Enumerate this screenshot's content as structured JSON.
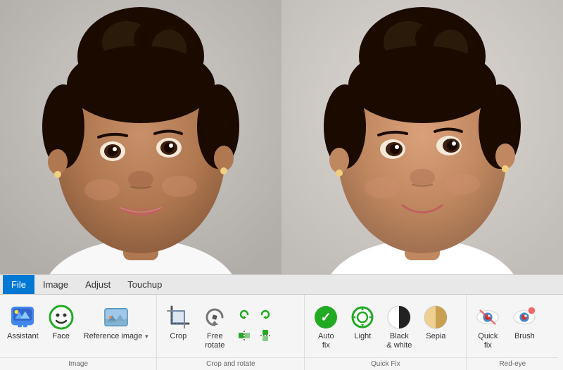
{
  "photos": {
    "left_alt": "Original portrait photo of young girl",
    "right_alt": "Edited portrait photo of young girl"
  },
  "menu": {
    "items": [
      {
        "id": "file",
        "label": "File",
        "active": true
      },
      {
        "id": "image",
        "label": "Image",
        "active": false
      },
      {
        "id": "adjust",
        "label": "Adjust",
        "active": false
      },
      {
        "id": "touchup",
        "label": "Touchup",
        "active": false
      }
    ]
  },
  "sections": {
    "image": {
      "label": "Image",
      "tools": [
        {
          "id": "assistant",
          "label": "Assistant",
          "icon": "assistant-icon"
        },
        {
          "id": "face",
          "label": "Face",
          "icon": "face-icon"
        },
        {
          "id": "reference-image",
          "label": "Reference\nimage",
          "icon": "reference-image-icon",
          "dropdown": true
        }
      ]
    },
    "crop_rotate": {
      "label": "Crop and rotate",
      "tools": [
        {
          "id": "crop",
          "label": "Crop",
          "icon": "crop-icon"
        },
        {
          "id": "free-rotate",
          "label": "Free\nrotate",
          "icon": "free-rotate-icon"
        }
      ]
    },
    "quick_fix": {
      "label": "Quick Fix",
      "tools": [
        {
          "id": "auto-fix",
          "label": "Auto\nfix",
          "icon": "auto-fix-icon"
        },
        {
          "id": "light",
          "label": "Light",
          "icon": "light-icon"
        },
        {
          "id": "black-white",
          "label": "Black\n& white",
          "icon": "black-white-icon"
        },
        {
          "id": "sepia",
          "label": "Sepia",
          "icon": "sepia-icon"
        }
      ]
    },
    "red_eye": {
      "label": "Red-eye",
      "tools": [
        {
          "id": "quick-fix-eye",
          "label": "Quick\nfix",
          "icon": "quick-fix-eye-icon"
        },
        {
          "id": "brush",
          "label": "Brush",
          "icon": "brush-icon"
        }
      ]
    }
  }
}
